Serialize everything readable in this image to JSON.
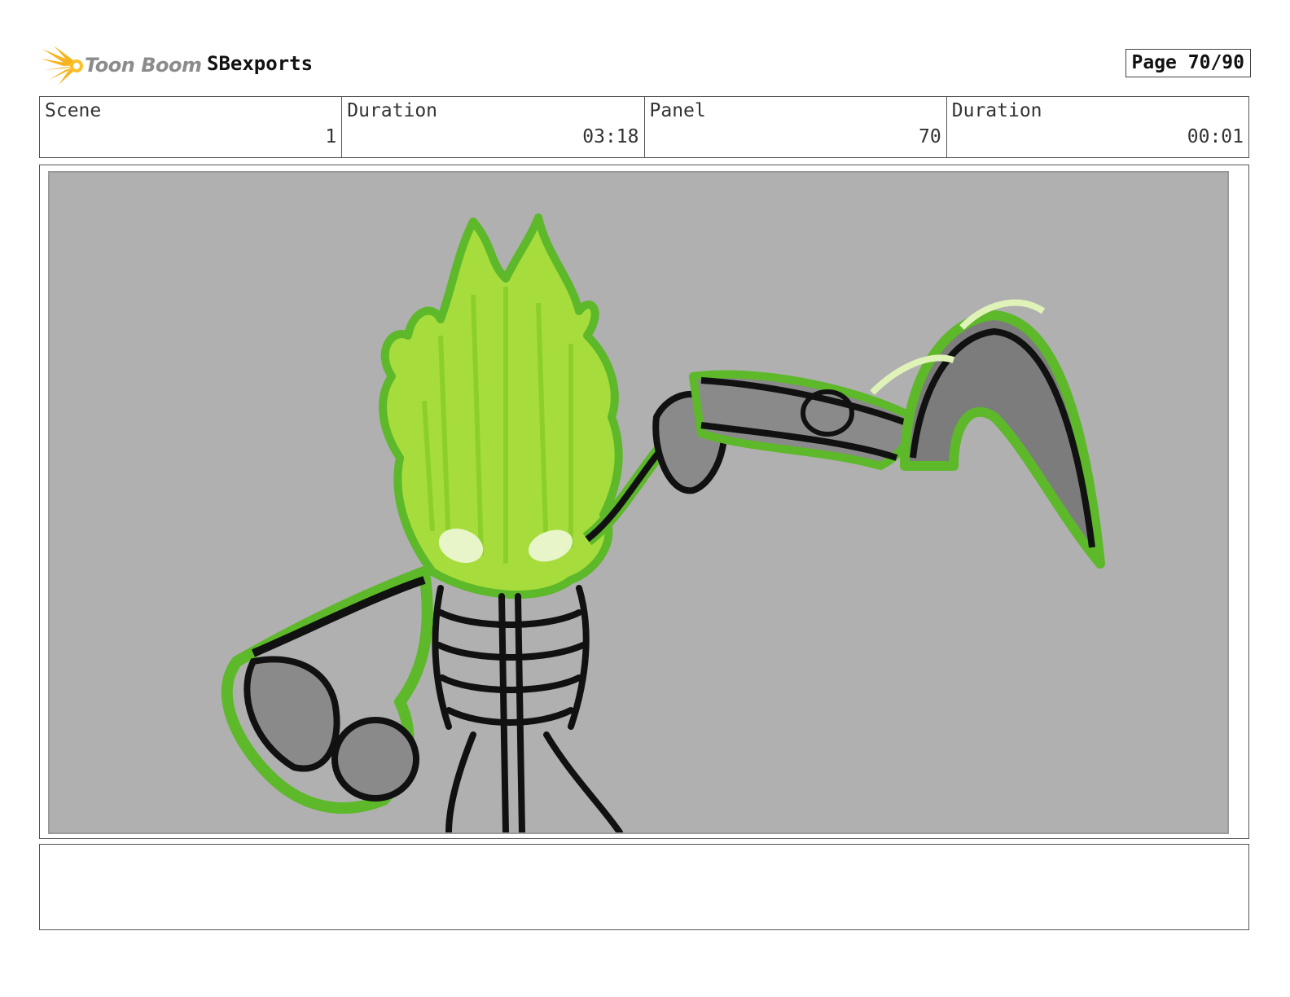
{
  "header": {
    "logo_text": "Toon Boom",
    "project_name": "SBexports",
    "page_label": "Page 70/90"
  },
  "info": {
    "scene_label": "Scene",
    "scene_value": "1",
    "scene_duration_label": "Duration",
    "scene_duration_value": "03:18",
    "panel_label": "Panel",
    "panel_value": "70",
    "panel_duration_label": "Duration",
    "panel_duration_value": "00:01"
  },
  "colors": {
    "background_gray": "#b0b0b0",
    "flame_green": "#a6dd3c",
    "flame_outline": "#5db82a",
    "ink": "#111111",
    "logo_yellow": "#f6b31c"
  },
  "notes": {
    "text": ""
  }
}
